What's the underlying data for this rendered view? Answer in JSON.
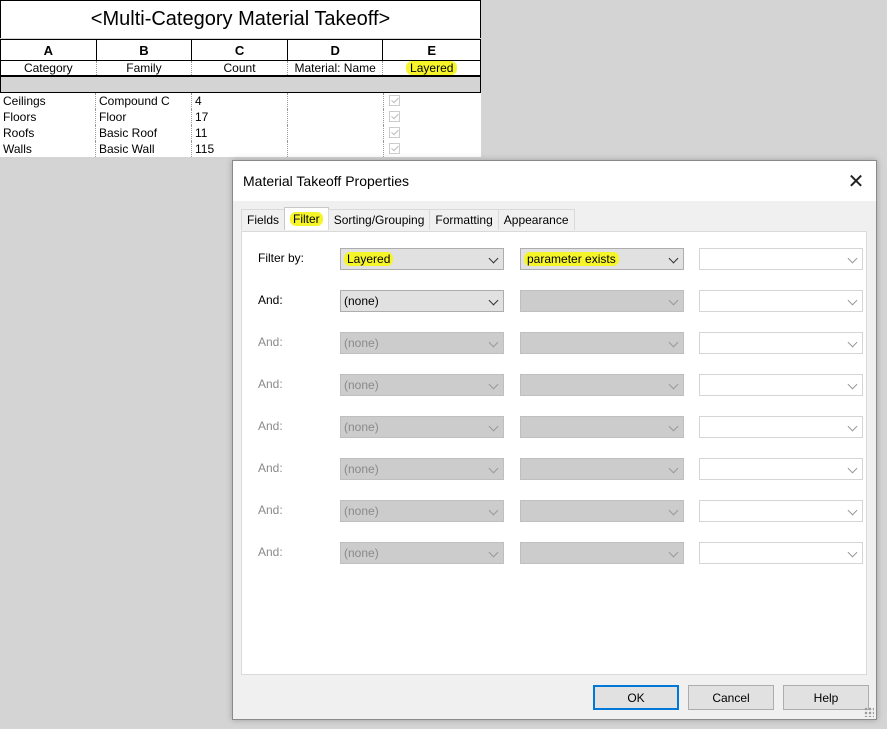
{
  "schedule": {
    "title": "<Multi-Category Material Takeoff>",
    "column_letters": [
      "A",
      "B",
      "C",
      "D",
      "E"
    ],
    "column_headers": [
      "Category",
      "Family",
      "Count",
      "Material: Name",
      "Layered"
    ],
    "rows": [
      {
        "category": "Ceilings",
        "family": "Compound C",
        "count": "4",
        "material": ""
      },
      {
        "category": "Floors",
        "family": "Floor",
        "count": "17",
        "material": ""
      },
      {
        "category": "Roofs",
        "family": "Basic Roof",
        "count": "11",
        "material": ""
      },
      {
        "category": "Walls",
        "family": "Basic Wall",
        "count": "115",
        "material": ""
      }
    ]
  },
  "dialog": {
    "title": "Material Takeoff Properties",
    "close_glyph": "✕",
    "tabs": [
      "Fields",
      "Filter",
      "Sorting/Grouping",
      "Formatting",
      "Appearance"
    ],
    "active_tab": "Filter",
    "filters": [
      {
        "label": "Filter by:",
        "field": "Layered",
        "operator": "parameter exists",
        "value": ""
      },
      {
        "label": "And:",
        "field": "(none)",
        "operator": "",
        "value": ""
      },
      {
        "label": "And:",
        "field": "(none)",
        "operator": "",
        "value": ""
      },
      {
        "label": "And:",
        "field": "(none)",
        "operator": "",
        "value": ""
      },
      {
        "label": "And:",
        "field": "(none)",
        "operator": "",
        "value": ""
      },
      {
        "label": "And:",
        "field": "(none)",
        "operator": "",
        "value": ""
      },
      {
        "label": "And:",
        "field": "(none)",
        "operator": "",
        "value": ""
      },
      {
        "label": "And:",
        "field": "(none)",
        "operator": "",
        "value": ""
      }
    ],
    "buttons": {
      "ok": "OK",
      "cancel": "Cancel",
      "help": "Help"
    }
  },
  "colors": {
    "highlight": "#f5f52a",
    "ok_border": "#0078d7"
  }
}
